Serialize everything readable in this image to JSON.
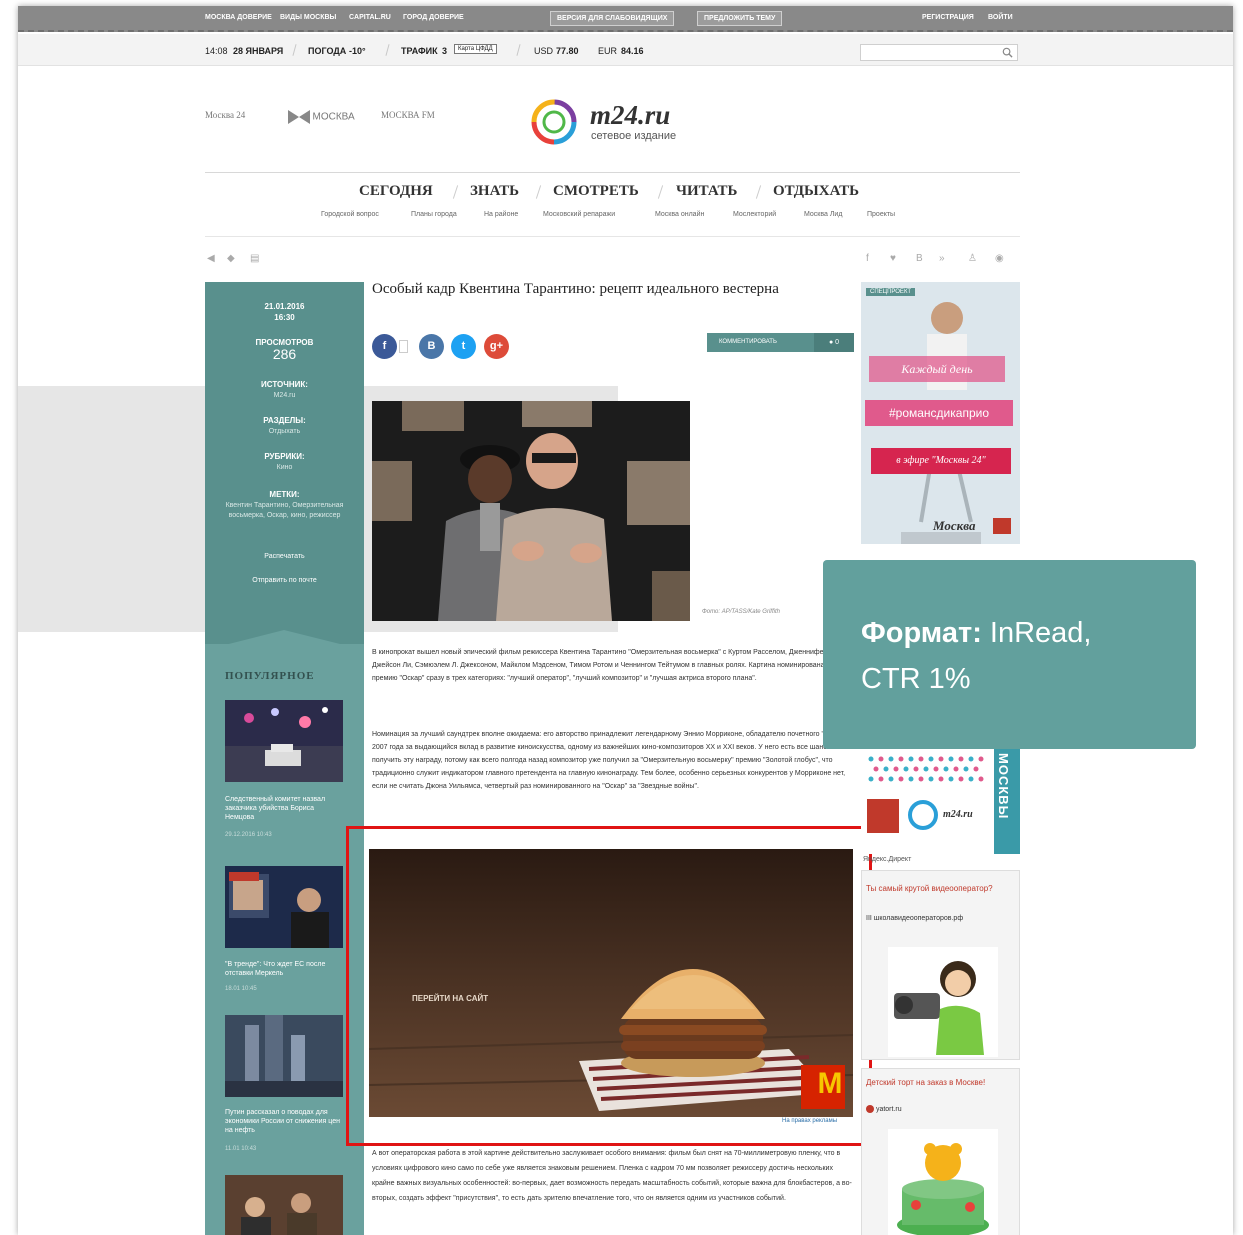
{
  "topbar": {
    "links": [
      "МОСКВА ДОВЕРИЕ",
      "ВИДЫ МОСКВЫ",
      "CAPITAL.RU",
      "ГОРОД ДОВЕРИЕ"
    ],
    "buttons": [
      "ВЕРСИЯ ДЛЯ СЛАБОВИДЯЩИХ",
      "ПРЕДЛОЖИТЬ ТЕМУ"
    ],
    "auth": [
      "РЕГИСТРАЦИЯ",
      "ВОЙТИ"
    ]
  },
  "infobar": {
    "time": "14:08",
    "date": "28 ЯНВАРЯ",
    "weather_label": "ПОГОДА",
    "weather_value": "-10°",
    "traffic_label": "ТРАФИК",
    "traffic_value": "3",
    "traffic_box": "Карта ЦФДД",
    "usd_label": "USD",
    "usd_value": "77.80",
    "eur_label": "EUR",
    "eur_value": "84.16"
  },
  "logos": {
    "partner1": "Москва 24",
    "partner2": "МОСКВА",
    "partner3": "МОСКВА FM",
    "site_name": "m24.ru",
    "site_sub": "сетевое издание"
  },
  "nav": {
    "main": [
      "СЕГОДНЯ",
      "ЗНАТЬ",
      "СМОТРЕТЬ",
      "ЧИТАТЬ",
      "ОТДЫХАТЬ"
    ],
    "sub": [
      "Городской вопрос",
      "Планы города",
      "На районе",
      "Московский репаражи",
      "Москва онлайн",
      "Мослекторий",
      "Москва Лид",
      "Проекты"
    ]
  },
  "meta": {
    "date": "21.01.2016",
    "time": "16:30",
    "views_label": "ПРОСМОТРОВ",
    "views_value": "286",
    "source_label": "ИСТОЧНИК:",
    "source_value": "M24.ru",
    "sections_label": "РАЗДЕЛЫ:",
    "sections_value": "Отдыхать",
    "rubrics_label": "РУБРИКИ:",
    "rubrics_value": "Кино",
    "tags_label": "МЕТКИ:",
    "tags_value": "Квентин Тарантино, Омерзительная восьмерка, Оскар, кино, режиссер",
    "print": "Распечатать",
    "email": "Отправить по почте"
  },
  "popular": {
    "title": "ПОПУЛЯРНОЕ",
    "items": [
      {
        "caption": "Следственный комитет назвал заказчика убийства Бориса Немцова",
        "date": "29.12.2016 10:43"
      },
      {
        "caption": "\"В тренде\": Что ждет ЕС после отставки Меркель",
        "date": "18.01 10:45"
      },
      {
        "caption": "Путин рассказал о поводах для экономики России от снижения цен на нефть",
        "date": "11.01 10:43"
      }
    ]
  },
  "article": {
    "title": "Особый кадр Квентина Тарантино: рецепт идеального вестерна",
    "share": [
      "f",
      "В",
      "t",
      "g+"
    ],
    "comment_label": "КОММЕНТИРОВАТЬ",
    "comment_count": "0",
    "photo_credit": "Фото: AP/TASS/Kate Griffith",
    "para1": "В кинопрокат вышел новый эпический фильм режиссера Квентина Тарантино \"Омерзительная восьмерка\" с Куртом Расселом, Дженнифер Джейсон Ли, Сэмюэлем Л. Джексоном, Майклом Мэдсеном, Тимом Ротом и Ченнингом Тейтумом в главных ролях. Картина номинирована на премию \"Оскар\" сразу в трех категориях: \"лучший оператор\", \"лучший композитор\" и \"лучшая актриса второго плана\".",
    "para2": "Номинация за лучший саундтрек вполне ожидаема: его авторство принадлежит легендарному Эннио Морриконе, обладателю почетного \"Оскара\" 2007 года за выдающийся вклад в развитие киноискусства, одному из важнейших кино-композиторов XX и XXI веков. У него есть все шансы получить эту награду, потому как всего полгода назад композитор уже получил за \"Омерзительную восьмерку\" премию \"Золотой глобус\", что традиционно служит индикатором главного претендента на главную кинонаграду. Тем более, особенно серьезных конкурентов у Морриконе нет, если не считать Джона Уильямса, четвертый раз номинированного на \"Оскар\" за \"Звездные войны\".",
    "para3": "А вот операторская работа в этой картине действительно заслуживает особого внимания: фильм был снят на 70-миллиметровую пленку, что в условиях цифрового кино само по себе уже является знаковым решением. Пленка с кадром 70 мм позволяет режиссеру достичь нескольких крайне важных визуальных особенностей: во-первых, дает возможность передать масштабность событий, которые важна для блокбастеров, а во-вторых, создать эффект \"присутствия\", то есть дать зрителю впечатление того, что он является одним из участников событий."
  },
  "ad": {
    "cta": "ПЕРЕЙТИ НА САЙТ",
    "brand": "M",
    "footer": "На правах рекламы"
  },
  "right": {
    "promo_tag": "СПЕЦПРОЕКТ",
    "promo_line1": "Каждый день",
    "promo_line2": "#романсдикаприо",
    "promo_line3": "в эфире \"Москвы 24\"",
    "promo_brand": "Москва",
    "vertical": "МОСКВЫ",
    "partner_small": "m24.ru",
    "direct_label": "Яндекс.Директ",
    "ad1_title": "Ты самый крутой видеооператор?",
    "ad1_text": "III школавидеооператоров.рф",
    "ad2_title": "Детский торт на заказ в Москве!",
    "ad2_text": "yatort.ru"
  },
  "callout": {
    "label": "Формат:",
    "value": "InRead, CTR 1%"
  }
}
